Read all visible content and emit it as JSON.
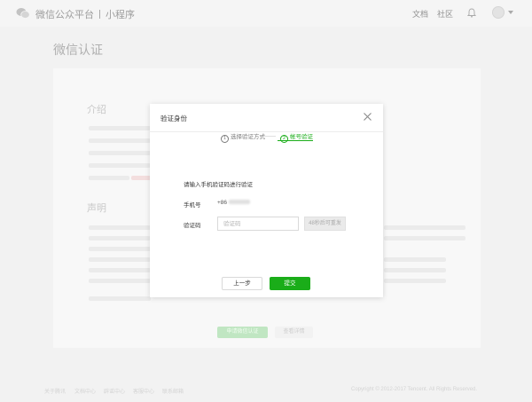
{
  "header": {
    "platform": "微信公众平台",
    "product": "小程序",
    "links": [
      "文档",
      "社区"
    ],
    "icons": {
      "logo": "wechat-logo-icon",
      "bell": "bell-icon",
      "avatar": "avatar-icon",
      "caret": "chevron-down-icon"
    }
  },
  "page": {
    "title": "微信认证",
    "intro_title": "介绍",
    "statement_title": "声明",
    "apply_label": "申请微信认证",
    "details_label": "查看详情"
  },
  "footer": {
    "links": [
      "关于腾讯",
      "文档中心",
      "辟谣中心",
      "客服中心",
      "联系邮箱"
    ],
    "copyright": "Copyright © 2012-2017 Tencent. All Rights Reserved."
  },
  "modal": {
    "title": "验证身份",
    "close_icon": "close-icon",
    "steps": [
      {
        "num": "1",
        "label": "选择验证方式",
        "active": false
      },
      {
        "num": "2",
        "label": "帐号验证",
        "active": true
      }
    ],
    "hint": "请输入手机验证码进行验证",
    "phone_label": "手机号",
    "phone_value": "+86",
    "code_label": "验证码",
    "code_placeholder": "验证码",
    "resend_label": "48秒后可重发",
    "prev_label": "上一步",
    "submit_label": "提交"
  },
  "colors": {
    "accent": "#1aad19",
    "background": "#f2f2f2",
    "modal": "#ffffff"
  }
}
